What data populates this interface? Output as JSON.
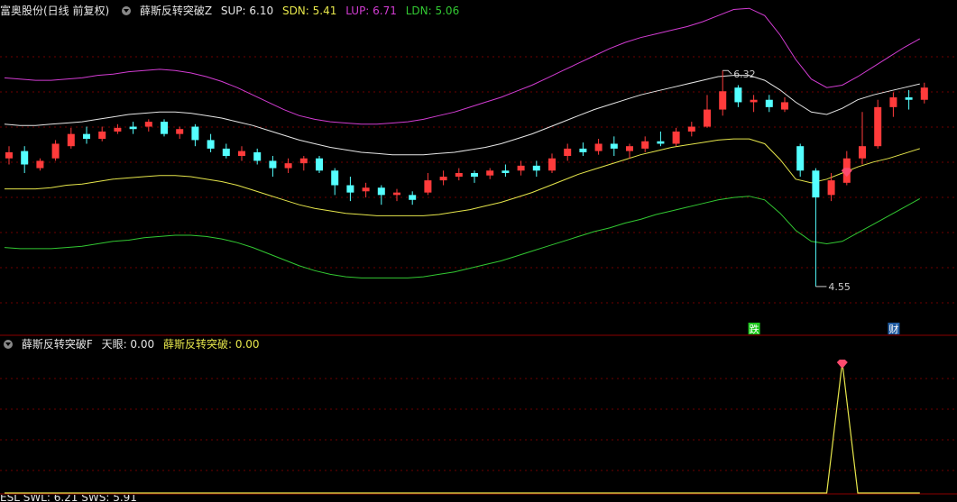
{
  "main_header": {
    "stock": "富奥股份(日线 前复权)",
    "indicator": "薛斯反转突破Z",
    "sup_label": "SUP: 6.10",
    "sdn_label": "SDN: 5.41",
    "lup_label": "LUP: 6.71",
    "ldn_label": "LDN: 5.06"
  },
  "sub_header": {
    "indicator": "薛斯反转突破F",
    "tianyan_label": "天眼: 0.00",
    "breakout_label": "薛斯反转突破: 0.00"
  },
  "bottom_header": {
    "text": "ESL  SWL: 6.21  SWS: 5.91"
  },
  "colors": {
    "up": "#ff3b3b",
    "down": "#54ffff",
    "sup": "#e6e6e6",
    "sdn": "#e6e64b",
    "lup": "#d23cd2",
    "ldn": "#32c832",
    "grid": "#6e0000",
    "panel_border": "#8b0000"
  },
  "annotations": {
    "high_label": "6.32",
    "low_label": "4.55",
    "event_die": "跌",
    "event_cai": "财"
  },
  "chart_data": [
    {
      "type": "candlestick",
      "title": "薛斯反转突破Z",
      "ylim": [
        4.35,
        6.75
      ],
      "series": [
        {
          "name": "SUP",
          "values": [
            5.88,
            5.87,
            5.87,
            5.88,
            5.89,
            5.9,
            5.92,
            5.94,
            5.96,
            5.97,
            5.98,
            5.98,
            5.97,
            5.95,
            5.93,
            5.9,
            5.87,
            5.83,
            5.79,
            5.75,
            5.72,
            5.69,
            5.67,
            5.65,
            5.64,
            5.63,
            5.63,
            5.63,
            5.64,
            5.65,
            5.67,
            5.69,
            5.72,
            5.76,
            5.8,
            5.85,
            5.9,
            5.95,
            6.0,
            6.04,
            6.08,
            6.12,
            6.15,
            6.18,
            6.21,
            6.24,
            6.27,
            6.28,
            6.28,
            6.24,
            6.16,
            6.06,
            5.98,
            5.96,
            6.01,
            6.08,
            6.12,
            6.15,
            6.18,
            6.21
          ]
        },
        {
          "name": "SDN",
          "values": [
            5.35,
            5.35,
            5.35,
            5.36,
            5.38,
            5.39,
            5.41,
            5.43,
            5.44,
            5.45,
            5.46,
            5.46,
            5.45,
            5.43,
            5.41,
            5.38,
            5.34,
            5.3,
            5.26,
            5.22,
            5.19,
            5.17,
            5.15,
            5.14,
            5.13,
            5.13,
            5.13,
            5.13,
            5.14,
            5.16,
            5.18,
            5.21,
            5.24,
            5.28,
            5.32,
            5.37,
            5.42,
            5.47,
            5.51,
            5.55,
            5.59,
            5.63,
            5.66,
            5.69,
            5.71,
            5.73,
            5.75,
            5.76,
            5.76,
            5.72,
            5.59,
            5.43,
            5.4,
            5.43,
            5.48,
            5.53,
            5.57,
            5.6,
            5.64,
            5.68
          ]
        },
        {
          "name": "LUP",
          "values": [
            6.26,
            6.25,
            6.24,
            6.24,
            6.25,
            6.26,
            6.28,
            6.29,
            6.31,
            6.32,
            6.33,
            6.32,
            6.3,
            6.27,
            6.23,
            6.18,
            6.12,
            6.06,
            6.0,
            5.95,
            5.92,
            5.9,
            5.89,
            5.88,
            5.88,
            5.89,
            5.9,
            5.92,
            5.95,
            5.98,
            6.02,
            6.06,
            6.1,
            6.15,
            6.2,
            6.26,
            6.32,
            6.38,
            6.44,
            6.5,
            6.55,
            6.59,
            6.62,
            6.65,
            6.68,
            6.72,
            6.77,
            6.82,
            6.83,
            6.77,
            6.61,
            6.41,
            6.25,
            6.18,
            6.2,
            6.27,
            6.35,
            6.43,
            6.51,
            6.58
          ]
        },
        {
          "name": "LDN",
          "values": [
            4.87,
            4.86,
            4.86,
            4.86,
            4.87,
            4.88,
            4.9,
            4.92,
            4.93,
            4.95,
            4.96,
            4.97,
            4.97,
            4.96,
            4.94,
            4.91,
            4.87,
            4.82,
            4.77,
            4.72,
            4.68,
            4.65,
            4.63,
            4.62,
            4.62,
            4.62,
            4.62,
            4.63,
            4.65,
            4.67,
            4.7,
            4.73,
            4.76,
            4.8,
            4.84,
            4.88,
            4.92,
            4.96,
            5.0,
            5.03,
            5.07,
            5.1,
            5.14,
            5.17,
            5.2,
            5.23,
            5.26,
            5.28,
            5.29,
            5.26,
            5.15,
            5.01,
            4.92,
            4.9,
            4.92,
            4.99,
            5.06,
            5.13,
            5.2,
            5.27
          ]
        }
      ],
      "candles": [
        [
          5.6,
          5.65,
          5.7,
          5.55
        ],
        [
          5.66,
          5.55,
          5.7,
          5.48
        ],
        [
          5.52,
          5.58,
          5.6,
          5.5
        ],
        [
          5.6,
          5.72,
          5.75,
          5.58
        ],
        [
          5.7,
          5.8,
          5.85,
          5.68
        ],
        [
          5.8,
          5.76,
          5.86,
          5.72
        ],
        [
          5.76,
          5.82,
          5.86,
          5.74
        ],
        [
          5.82,
          5.85,
          5.88,
          5.8
        ],
        [
          5.86,
          5.84,
          5.9,
          5.8
        ],
        [
          5.86,
          5.9,
          5.92,
          5.82
        ],
        [
          5.9,
          5.8,
          5.92,
          5.78
        ],
        [
          5.8,
          5.84,
          5.86,
          5.76
        ],
        [
          5.86,
          5.75,
          5.88,
          5.7
        ],
        [
          5.75,
          5.68,
          5.8,
          5.65
        ],
        [
          5.68,
          5.62,
          5.72,
          5.6
        ],
        [
          5.62,
          5.66,
          5.7,
          5.58
        ],
        [
          5.65,
          5.58,
          5.68,
          5.55
        ],
        [
          5.58,
          5.52,
          5.62,
          5.45
        ],
        [
          5.52,
          5.56,
          5.6,
          5.48
        ],
        [
          5.56,
          5.6,
          5.62,
          5.5
        ],
        [
          5.6,
          5.5,
          5.62,
          5.48
        ],
        [
          5.5,
          5.38,
          5.52,
          5.3
        ],
        [
          5.38,
          5.32,
          5.45,
          5.25
        ],
        [
          5.33,
          5.36,
          5.4,
          5.28
        ],
        [
          5.36,
          5.3,
          5.38,
          5.22
        ],
        [
          5.3,
          5.32,
          5.35,
          5.25
        ],
        [
          5.3,
          5.26,
          5.33,
          5.22
        ],
        [
          5.32,
          5.42,
          5.48,
          5.3
        ],
        [
          5.42,
          5.45,
          5.5,
          5.38
        ],
        [
          5.45,
          5.48,
          5.52,
          5.42
        ],
        [
          5.48,
          5.45,
          5.5,
          5.4
        ],
        [
          5.46,
          5.5,
          5.52,
          5.43
        ],
        [
          5.5,
          5.48,
          5.55,
          5.45
        ],
        [
          5.5,
          5.54,
          5.58,
          5.46
        ],
        [
          5.54,
          5.5,
          5.58,
          5.45
        ],
        [
          5.5,
          5.6,
          5.64,
          5.48
        ],
        [
          5.62,
          5.68,
          5.72,
          5.58
        ],
        [
          5.68,
          5.65,
          5.73,
          5.62
        ],
        [
          5.66,
          5.72,
          5.76,
          5.63
        ],
        [
          5.72,
          5.68,
          5.78,
          5.62
        ],
        [
          5.66,
          5.7,
          5.72,
          5.6
        ],
        [
          5.68,
          5.74,
          5.78,
          5.65
        ],
        [
          5.74,
          5.72,
          5.82,
          5.7
        ],
        [
          5.72,
          5.82,
          5.85,
          5.7
        ],
        [
          5.82,
          5.86,
          5.9,
          5.78
        ],
        [
          5.86,
          6.0,
          6.12,
          5.85
        ],
        [
          6.0,
          6.15,
          6.32,
          5.95
        ],
        [
          6.18,
          6.06,
          6.2,
          6.02
        ],
        [
          6.06,
          6.08,
          6.12,
          5.98
        ],
        [
          6.08,
          6.02,
          6.12,
          5.98
        ],
        [
          6.0,
          6.06,
          6.1,
          5.98
        ],
        [
          5.7,
          5.5,
          5.72,
          5.45
        ],
        [
          5.5,
          5.28,
          5.52,
          4.55
        ],
        [
          5.3,
          5.42,
          5.48,
          5.25
        ],
        [
          5.4,
          5.6,
          5.66,
          5.38
        ],
        [
          5.6,
          5.7,
          5.98,
          5.55
        ],
        [
          5.7,
          6.02,
          6.08,
          5.68
        ],
        [
          6.02,
          6.1,
          6.14,
          5.94
        ],
        [
          6.1,
          6.08,
          6.16,
          6.0
        ],
        [
          6.08,
          6.18,
          6.22,
          6.05
        ]
      ],
      "high_label": "6.32",
      "low_label": "4.55",
      "event_labels": [
        "跌",
        "财"
      ]
    },
    {
      "type": "line",
      "title": "薛斯反转突破F",
      "ylim": [
        0,
        1
      ],
      "series": [
        {
          "name": "薛斯反转突破",
          "values": [
            0,
            0,
            0,
            0,
            0,
            0,
            0,
            0,
            0,
            0,
            0,
            0,
            0,
            0,
            0,
            0,
            0,
            0,
            0,
            0,
            0,
            0,
            0,
            0,
            0,
            0,
            0,
            0,
            0,
            0,
            0,
            0,
            0,
            0,
            0,
            0,
            0,
            0,
            0,
            0,
            0,
            0,
            0,
            0,
            0,
            0,
            0,
            0,
            0,
            0,
            0,
            0,
            0,
            0,
            1,
            0,
            0,
            0,
            0,
            0
          ]
        }
      ]
    }
  ]
}
